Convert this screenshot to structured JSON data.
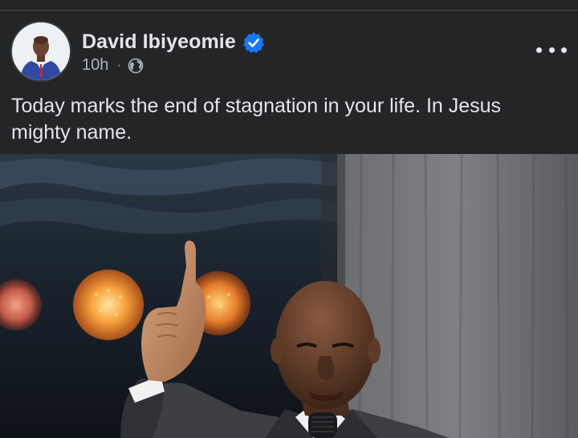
{
  "post": {
    "author": {
      "name": "David Ibiyeomie",
      "verified": true,
      "avatar": "avatar-photo"
    },
    "meta": {
      "time": "10h",
      "separator": "·",
      "audience_icon": "globe-icon"
    },
    "more_icon": "more-horizontal-icon",
    "text": "Today marks the end of stagnation in your life. In Jesus mighty name.",
    "image": {
      "description_icon": "post-photo"
    }
  },
  "colors": {
    "background": "#242526",
    "primary_text": "#e4e6eb",
    "secondary_text": "#b0b3b8",
    "verified_blue": "#1877f2"
  }
}
